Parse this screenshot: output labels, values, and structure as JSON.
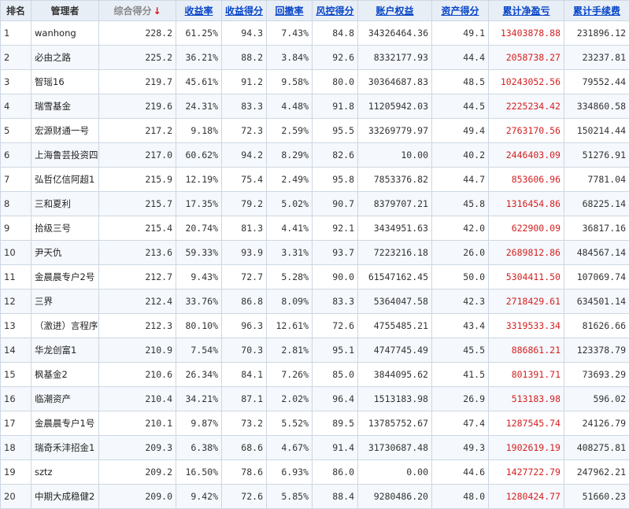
{
  "table": {
    "headers": {
      "rank": "排名",
      "manager": "管理者",
      "composite_score": "综合得分",
      "return_rate": "收益率",
      "return_score": "收益得分",
      "drawdown_rate": "回撤率",
      "risk_score": "风控得分",
      "equity": "账户权益",
      "asset_score": "资产得分",
      "net_pnl": "累计净盈亏",
      "fees": "累计手续费"
    },
    "sort_indicator": "↓",
    "rows": [
      {
        "rank": "1",
        "manager": "wanhong",
        "composite": "228.2",
        "return_rate": "61.25%",
        "return_score": "94.3",
        "drawdown": "7.43%",
        "risk": "84.8",
        "equity": "34326464.36",
        "asset": "49.1",
        "pnl": "13403878.88",
        "fees": "231896.12"
      },
      {
        "rank": "2",
        "manager": "必由之路",
        "composite": "225.2",
        "return_rate": "36.21%",
        "return_score": "88.2",
        "drawdown": "3.84%",
        "risk": "92.6",
        "equity": "8332177.93",
        "asset": "44.4",
        "pnl": "2058738.27",
        "fees": "23237.81"
      },
      {
        "rank": "3",
        "manager": "智瑶16",
        "composite": "219.7",
        "return_rate": "45.61%",
        "return_score": "91.2",
        "drawdown": "9.58%",
        "risk": "80.0",
        "equity": "30364687.83",
        "asset": "48.5",
        "pnl": "10243052.56",
        "fees": "79552.44"
      },
      {
        "rank": "4",
        "manager": "瑞雪基金",
        "composite": "219.6",
        "return_rate": "24.31%",
        "return_score": "83.3",
        "drawdown": "4.48%",
        "risk": "91.8",
        "equity": "11205942.03",
        "asset": "44.5",
        "pnl": "2225234.42",
        "fees": "334860.58"
      },
      {
        "rank": "5",
        "manager": "宏源财通一号",
        "composite": "217.2",
        "return_rate": "9.18%",
        "return_score": "72.3",
        "drawdown": "2.59%",
        "risk": "95.5",
        "equity": "33269779.97",
        "asset": "49.4",
        "pnl": "2763170.56",
        "fees": "150214.44"
      },
      {
        "rank": "6",
        "manager": "上海鲁芸投资四",
        "composite": "217.0",
        "return_rate": "60.62%",
        "return_score": "94.2",
        "drawdown": "8.29%",
        "risk": "82.6",
        "equity": "10.00",
        "asset": "40.2",
        "pnl": "2446403.09",
        "fees": "51276.91"
      },
      {
        "rank": "7",
        "manager": "弘哲亿信阿超1",
        "composite": "215.9",
        "return_rate": "12.19%",
        "return_score": "75.4",
        "drawdown": "2.49%",
        "risk": "95.8",
        "equity": "7853376.82",
        "asset": "44.7",
        "pnl": "853606.96",
        "fees": "7781.04"
      },
      {
        "rank": "8",
        "manager": "三和夏利",
        "composite": "215.7",
        "return_rate": "17.35%",
        "return_score": "79.2",
        "drawdown": "5.02%",
        "risk": "90.7",
        "equity": "8379707.21",
        "asset": "45.8",
        "pnl": "1316454.86",
        "fees": "68225.14"
      },
      {
        "rank": "9",
        "manager": "拾级三号",
        "composite": "215.4",
        "return_rate": "20.74%",
        "return_score": "81.3",
        "drawdown": "4.41%",
        "risk": "92.1",
        "equity": "3434951.63",
        "asset": "42.0",
        "pnl": "622900.09",
        "fees": "36817.16"
      },
      {
        "rank": "10",
        "manager": "尹天仇",
        "composite": "213.6",
        "return_rate": "59.33%",
        "return_score": "93.9",
        "drawdown": "3.31%",
        "risk": "93.7",
        "equity": "7223216.18",
        "asset": "26.0",
        "pnl": "2689812.86",
        "fees": "484567.14"
      },
      {
        "rank": "11",
        "manager": "金晨晨专户2号",
        "composite": "212.7",
        "return_rate": "9.43%",
        "return_score": "72.7",
        "drawdown": "5.28%",
        "risk": "90.0",
        "equity": "61547162.45",
        "asset": "50.0",
        "pnl": "5304411.50",
        "fees": "107069.74"
      },
      {
        "rank": "12",
        "manager": "三界",
        "composite": "212.4",
        "return_rate": "33.76%",
        "return_score": "86.8",
        "drawdown": "8.09%",
        "risk": "83.3",
        "equity": "5364047.58",
        "asset": "42.3",
        "pnl": "2718429.61",
        "fees": "634501.14"
      },
      {
        "rank": "13",
        "manager": "（激进）言程序",
        "composite": "212.3",
        "return_rate": "80.10%",
        "return_score": "96.3",
        "drawdown": "12.61%",
        "risk": "72.6",
        "equity": "4755485.21",
        "asset": "43.4",
        "pnl": "3319533.34",
        "fees": "81626.66"
      },
      {
        "rank": "14",
        "manager": "华龙创富1",
        "composite": "210.9",
        "return_rate": "7.54%",
        "return_score": "70.3",
        "drawdown": "2.81%",
        "risk": "95.1",
        "equity": "4747745.49",
        "asset": "45.5",
        "pnl": "886861.21",
        "fees": "123378.79"
      },
      {
        "rank": "15",
        "manager": "枫基金2",
        "composite": "210.6",
        "return_rate": "26.34%",
        "return_score": "84.1",
        "drawdown": "7.26%",
        "risk": "85.0",
        "equity": "3844095.62",
        "asset": "41.5",
        "pnl": "801391.71",
        "fees": "73693.29"
      },
      {
        "rank": "16",
        "manager": "临潮资产",
        "composite": "210.4",
        "return_rate": "34.21%",
        "return_score": "87.1",
        "drawdown": "2.02%",
        "risk": "96.4",
        "equity": "1513183.98",
        "asset": "26.9",
        "pnl": "513183.98",
        "fees": "596.02"
      },
      {
        "rank": "17",
        "manager": "金晨晨专户1号",
        "composite": "210.1",
        "return_rate": "9.87%",
        "return_score": "73.2",
        "drawdown": "5.52%",
        "risk": "89.5",
        "equity": "13785752.67",
        "asset": "47.4",
        "pnl": "1287545.74",
        "fees": "24126.79"
      },
      {
        "rank": "18",
        "manager": "瑞奇禾沣招金1",
        "composite": "209.3",
        "return_rate": "6.38%",
        "return_score": "68.6",
        "drawdown": "4.67%",
        "risk": "91.4",
        "equity": "31730687.48",
        "asset": "49.3",
        "pnl": "1902619.19",
        "fees": "408275.81"
      },
      {
        "rank": "19",
        "manager": "sztz",
        "composite": "209.2",
        "return_rate": "16.50%",
        "return_score": "78.6",
        "drawdown": "6.93%",
        "risk": "86.0",
        "equity": "0.00",
        "asset": "44.6",
        "pnl": "1427722.79",
        "fees": "247962.21"
      },
      {
        "rank": "20",
        "manager": "中期大成稳健2",
        "composite": "209.0",
        "return_rate": "9.42%",
        "return_score": "72.6",
        "drawdown": "5.85%",
        "risk": "88.4",
        "equity": "9280486.20",
        "asset": "48.0",
        "pnl": "1280424.77",
        "fees": "51660.23"
      }
    ]
  },
  "colors": {
    "header_bg": "#e8eef6",
    "link": "#0645c8",
    "pnl_red": "#d42020",
    "sort_arrow": "#e01010",
    "grid": "#cdd7e3"
  }
}
